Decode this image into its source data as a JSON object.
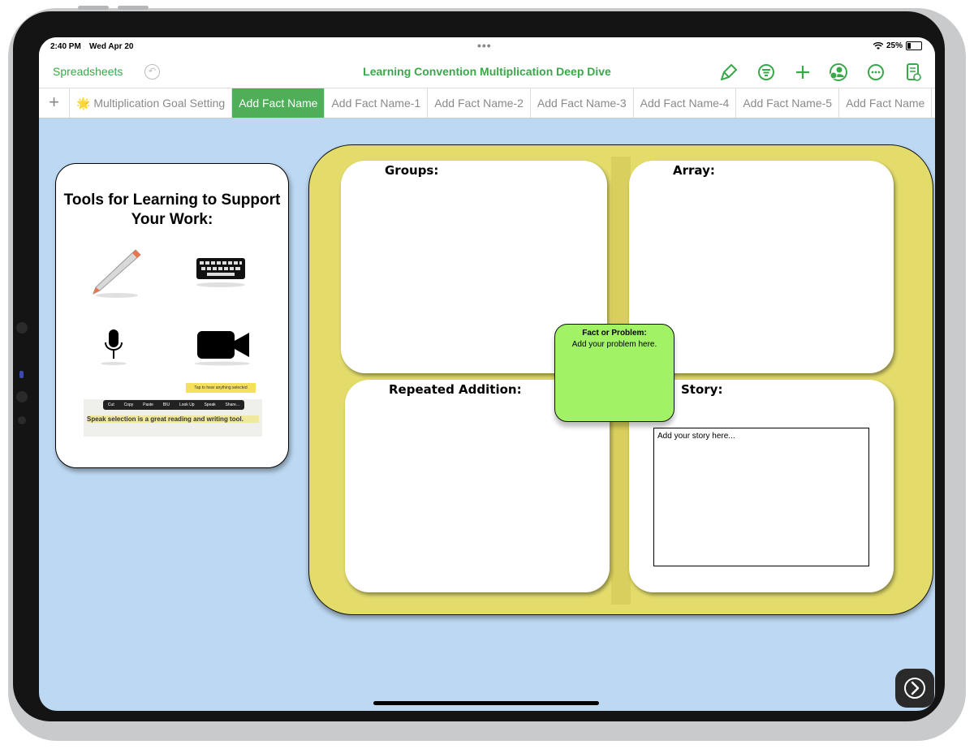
{
  "status_bar": {
    "time": "2:40 PM",
    "date": "Wed Apr 20",
    "battery": "25%"
  },
  "toolbar": {
    "back_label": "Spreadsheets",
    "title": "Learning Convention Multiplication  Deep Dive",
    "icons": [
      "undo-icon",
      "format-brush-icon",
      "organize-icon",
      "add-icon",
      "collaborate-icon",
      "more-icon",
      "document-view-icon"
    ],
    "accent_color": "#3aa84a"
  },
  "tabs": [
    {
      "label": "Multiplication Goal Setting",
      "emoji": "🌟",
      "active": false
    },
    {
      "label": "Add Fact Name",
      "active": true
    },
    {
      "label": "Add Fact Name-1",
      "active": false
    },
    {
      "label": "Add Fact Name-2",
      "active": false
    },
    {
      "label": "Add Fact Name-3",
      "active": false
    },
    {
      "label": "Add Fact Name-4",
      "active": false
    },
    {
      "label": "Add Fact Name-5",
      "active": false
    },
    {
      "label": "Add Fact Name",
      "active": false
    }
  ],
  "tools_card": {
    "title": "Tools for Learning to Support Your Work:",
    "tools": [
      "pencil-icon",
      "keyboard-icon",
      "microphone-icon",
      "video-camera-icon"
    ],
    "speak_demo": {
      "tooltip": "Tap to hear anything selected",
      "menu": [
        "Cut",
        "Copy",
        "Paste",
        "BIU",
        "Look Up",
        "Speak",
        "Share..."
      ],
      "text": "Speak selection is a great reading and writing tool."
    }
  },
  "mat": {
    "groups_label": "Groups:",
    "array_label": "Array:",
    "repeated_addition_label": "Repeated Addition:",
    "story_label": "Story:",
    "fact_title": "Fact or Problem:",
    "fact_body": "Add your problem here.",
    "story_placeholder": "Add your story here...",
    "colors": {
      "mat": "#e3dc6b",
      "fact_box": "#a2f266",
      "canvas": "#bcd8f2"
    }
  },
  "next_button_icon": "chevron-right-icon"
}
